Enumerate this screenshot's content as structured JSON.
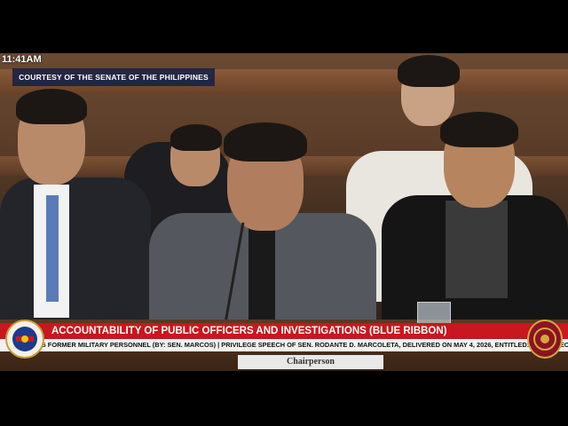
{
  "overlay": {
    "time": "11:41AM",
    "courtesy": "COURTESY OF THE SENATE OF THE PHILIPPINES",
    "committee_banner": "ACCOUNTABILITY OF PUBLIC OFFICERS AND INVESTIGATIONS (BLUE RIBBON)",
    "ticker": "G FORMER MILITARY PERSONNEL (BY: SEN. MARCOS) | PRIVILEGE SPEECH OF SEN. RODANTE D. MARCOLETA, DELIVERED ON MAY 4, 2026, ENTITLED: \"THE VIDEO STATEMENT OF FORI",
    "nameplate": "Chairperson"
  },
  "colors": {
    "banner": "#c8171e",
    "courtesy_bg": "#141e46",
    "ticker_bg": "#f2f2f2"
  },
  "icons": {
    "left_seal": "senate-seal-icon",
    "right_seal": "committee-seal-icon"
  }
}
